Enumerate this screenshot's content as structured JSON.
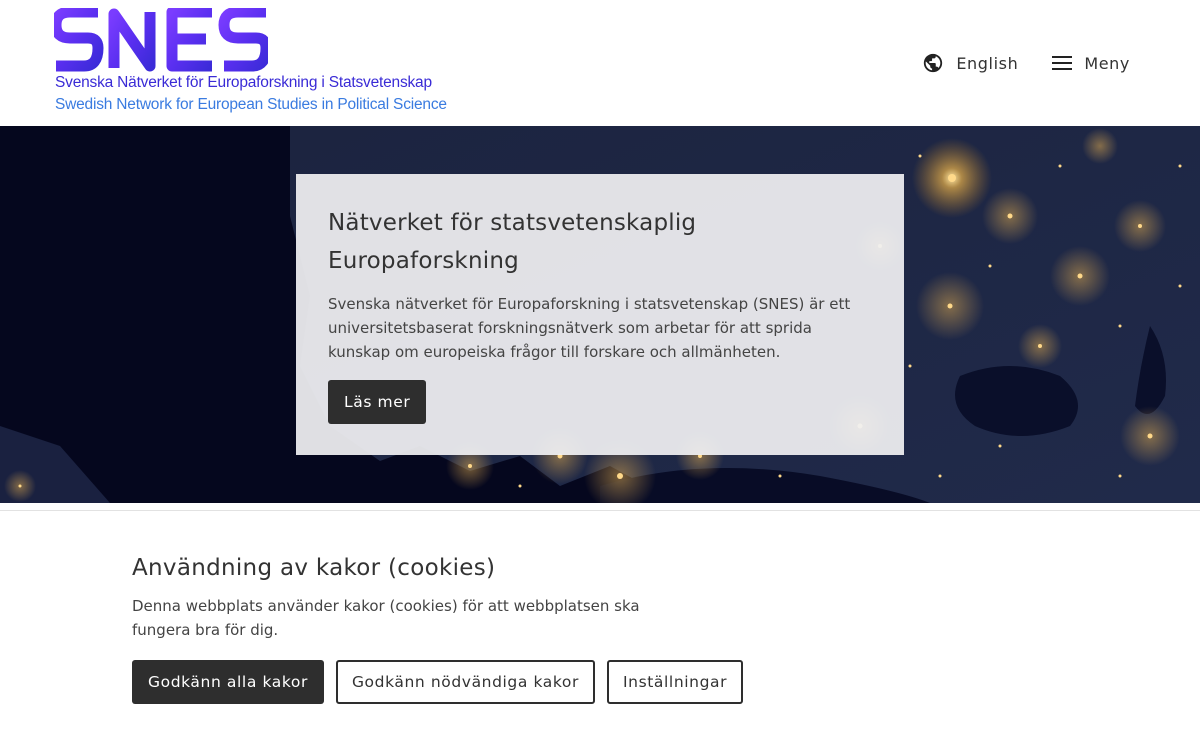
{
  "header": {
    "logo_letters": "SNES",
    "logo_line1": "Svenska Nätverket för Europaforskning i Statsvetenskap",
    "logo_line2": "Swedish Network for European Studies in Political Science",
    "language_label": "English",
    "menu_label": "Meny",
    "language_icon": "globe-icon",
    "menu_icon": "hamburger-icon"
  },
  "hero": {
    "title": "Nätverket för statsvetenskaplig Europaforskning",
    "text": "Svenska nätverket för Europaforskning i statsvetenskap (SNES) är ett universitetsbaserat forskningsnätverk som arbetar för att sprida kunskap om europeiska frågor till forskare och allmänheten.",
    "button_label": "Läs mer"
  },
  "cookie_banner": {
    "title": "Användning av kakor (cookies)",
    "text": "Denna webbplats använder kakor (cookies) för att webbplatsen ska fungera bra för dig.",
    "accept_all_label": "Godkänn alla kakor",
    "accept_necessary_label": "Godkänn nödvändiga kakor",
    "settings_label": "Inställningar"
  },
  "colors": {
    "logo_gradient_start": "#6a2ff2",
    "logo_gradient_end": "#3b2bd8",
    "logo_text_1": "#3a2bd6",
    "logo_text_2": "#3a7be0",
    "dark_button": "#2e2e2e",
    "hero_card_bg": "#f0f0f2"
  }
}
